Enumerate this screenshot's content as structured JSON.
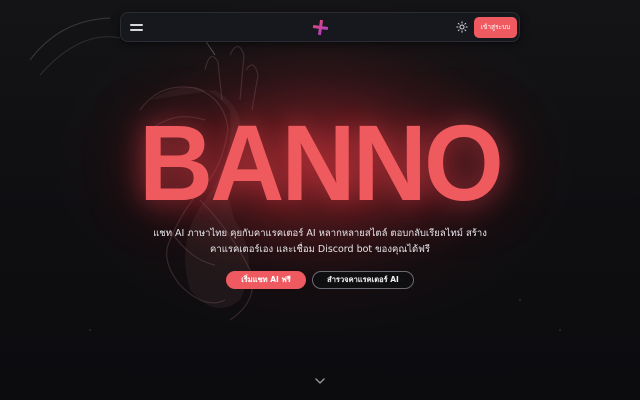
{
  "navbar": {
    "menu_icon": "hamburger-menu-icon",
    "logo_icon": "plus-logo-icon",
    "theme_icon": "sun-icon",
    "login_label": "เข้าสู่ระบบ"
  },
  "hero": {
    "title": "BANNO",
    "description": "แชท AI ภาษาไทย คุยกับคาแรคเตอร์ AI หลากหลายสไตล์ ตอบกลับเรียลไทม์ สร้างคาแรคเตอร์เอง และเชื่อม Discord bot ของคุณได้ฟรี",
    "primary_cta": "เริ่มแชท AI ฟรี",
    "secondary_cta": "สำรวจคาแรคเตอร์ AI",
    "scroll_icon": "chevron-down-icon"
  },
  "colors": {
    "accent": "#ef5a60",
    "background": "#0d0d10",
    "navbar": "#17181d",
    "logo_pink": "#e8407a",
    "logo_purple": "#a13bd8"
  }
}
